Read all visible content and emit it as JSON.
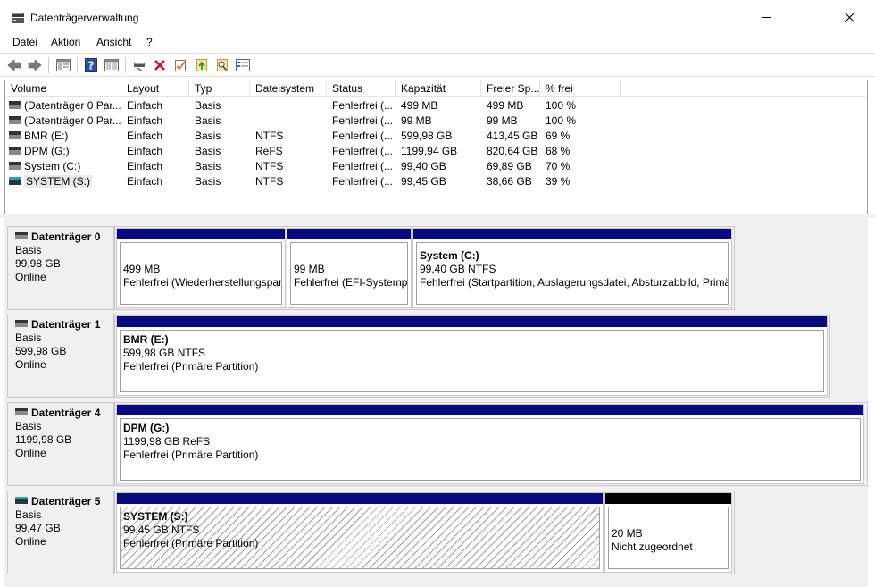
{
  "window": {
    "title": "Datenträgerverwaltung"
  },
  "menu": [
    "Datei",
    "Aktion",
    "Ansicht",
    "?"
  ],
  "toolbar": {
    "icons": [
      "back-icon",
      "forward-icon",
      "properties-view-icon",
      "help-icon",
      "console-icon",
      "connect-icon",
      "delete-icon",
      "check-icon",
      "import-icon",
      "search-icon",
      "list-icon"
    ]
  },
  "list": {
    "columns": [
      "Volume",
      "Layout",
      "Typ",
      "Dateisystem",
      "Status",
      "Kapazität",
      "Freier Sp...",
      "% frei"
    ],
    "rows": [
      {
        "volume": "(Datenträger 0 Par...",
        "layout": "Einfach",
        "typ": "Basis",
        "fs": "",
        "status": "Fehlerfrei (...",
        "cap": "499 MB",
        "free": "499 MB",
        "pct": "100 %"
      },
      {
        "volume": "(Datenträger 0 Par...",
        "layout": "Einfach",
        "typ": "Basis",
        "fs": "",
        "status": "Fehlerfrei (...",
        "cap": "99 MB",
        "free": "99 MB",
        "pct": "100 %"
      },
      {
        "volume": "BMR (E:)",
        "layout": "Einfach",
        "typ": "Basis",
        "fs": "NTFS",
        "status": "Fehlerfrei (...",
        "cap": "599,98 GB",
        "free": "413,45 GB",
        "pct": "69 %"
      },
      {
        "volume": "DPM (G:)",
        "layout": "Einfach",
        "typ": "Basis",
        "fs": "ReFS",
        "status": "Fehlerfrei (...",
        "cap": "1199,94 GB",
        "free": "820,64 GB",
        "pct": "68 %"
      },
      {
        "volume": "System (C:)",
        "layout": "Einfach",
        "typ": "Basis",
        "fs": "NTFS",
        "status": "Fehlerfrei (...",
        "cap": "99,40 GB",
        "free": "69,89 GB",
        "pct": "70 %"
      },
      {
        "volume": "SYSTEM (S:)",
        "layout": "Einfach",
        "typ": "Basis",
        "fs": "NTFS",
        "status": "Fehlerfrei (...",
        "cap": "99,45 GB",
        "free": "38,66 GB",
        "pct": "39 %"
      }
    ]
  },
  "disks": [
    {
      "name": "Datenträger 0",
      "type": "Basis",
      "size": "99,98 GB",
      "state": "Online",
      "partitions": [
        {
          "title": "",
          "size": "499 MB",
          "status": "Fehlerfrei (Wiederherstellungspar"
        },
        {
          "title": "",
          "size": "99 MB",
          "status": "Fehlerfrei (EFI-Systempa"
        },
        {
          "title": "System  (C:)",
          "size": "99,40 GB NTFS",
          "status": "Fehlerfrei (Startpartition, Auslagerungsdatei, Absturzabbild, Primä"
        }
      ]
    },
    {
      "name": "Datenträger 1",
      "type": "Basis",
      "size": "599,98 GB",
      "state": "Online",
      "partitions": [
        {
          "title": "BMR  (E:)",
          "size": "599,98 GB NTFS",
          "status": "Fehlerfrei (Primäre Partition)"
        }
      ]
    },
    {
      "name": "Datenträger 4",
      "type": "Basis",
      "size": "1199,98 GB",
      "state": "Online",
      "partitions": [
        {
          "title": "DPM  (G:)",
          "size": "1199,98 GB ReFS",
          "status": "Fehlerfrei (Primäre Partition)"
        }
      ]
    },
    {
      "name": "Datenträger 5",
      "type": "Basis",
      "size": "99,47 GB",
      "state": "Online",
      "partitions": [
        {
          "title": "SYSTEM  (S:)",
          "size": "99,45 GB NTFS",
          "status": "Fehlerfrei (Primäre Partition)"
        },
        {
          "title": "",
          "size": "20 MB",
          "status": "Nicht zugeordnet"
        }
      ]
    }
  ],
  "colors": {
    "primary_partition_bar": "#0a0a80",
    "unallocated_bar": "#000000"
  }
}
